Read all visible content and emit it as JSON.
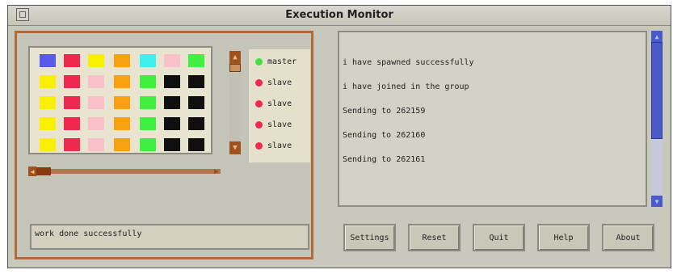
{
  "window": {
    "title": "Execution Monitor"
  },
  "grid": {
    "colors": {
      "blue": "#5a5ae8",
      "red": "#f02850",
      "yellow": "#f8f000",
      "orange": "#f8a010",
      "cyan": "#40f0f0",
      "pink": "#f8c0c8",
      "green": "#40f040",
      "black": "#101010"
    },
    "rows": [
      [
        "blue",
        "red",
        "yellow",
        "orange",
        "cyan",
        "pink",
        "green"
      ],
      [
        "yellow",
        "red",
        "pink",
        "orange",
        "green",
        "black",
        "black"
      ],
      [
        "yellow",
        "red",
        "pink",
        "orange",
        "green",
        "black",
        "black"
      ],
      [
        "yellow",
        "red",
        "pink",
        "orange",
        "green",
        "black",
        "black"
      ],
      [
        "yellow",
        "red",
        "pink",
        "orange",
        "green",
        "black",
        "black"
      ]
    ]
  },
  "legend": {
    "items": [
      {
        "label": "master",
        "color": "#40e040"
      },
      {
        "label": "slave",
        "color": "#f02850"
      },
      {
        "label": "slave",
        "color": "#f02850"
      },
      {
        "label": "slave",
        "color": "#f02850"
      },
      {
        "label": "slave",
        "color": "#f02850"
      }
    ]
  },
  "status": {
    "text": "work done successfully"
  },
  "log": {
    "lines": [
      "i have spawned successfully",
      "i have joined in the group",
      "Sending to 262159",
      "Sending to 262160",
      "Sending to 262161"
    ]
  },
  "buttons": {
    "settings": "Settings",
    "reset": "Reset",
    "quit": "Quit",
    "help": "Help",
    "about": "About"
  },
  "icons": {
    "window_menu": "window-menu-icon",
    "scroll_up": "arrow-up-icon",
    "scroll_down": "arrow-down-icon",
    "scroll_left": "arrow-left-icon",
    "scroll_right": "arrow-right-icon"
  }
}
